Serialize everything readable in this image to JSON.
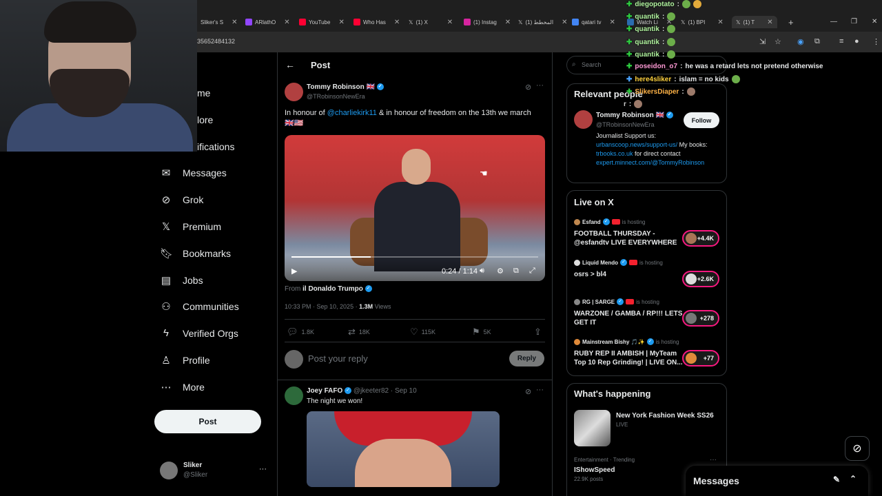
{
  "browser": {
    "tabs": [
      {
        "label": "Sliker's S",
        "color": "#7a7a7a"
      },
      {
        "label": "ARlathO",
        "color": "#9146ff"
      },
      {
        "label": "YouTube",
        "color": "#ff0033"
      },
      {
        "label": "Who Has",
        "color": "#ff0033"
      },
      {
        "label": "(1) X",
        "color": "#000000"
      },
      {
        "label": "(1) Instag",
        "color": "#d6249f"
      },
      {
        "label": "المخطط (1)",
        "color": "#000000"
      },
      {
        "label": "qatari tv",
        "color": "#4285f4"
      },
      {
        "label": "Watch Li",
        "color": "#2b6cb0"
      },
      {
        "label": "(1) BPI",
        "color": "#000000"
      },
      {
        "label": "(1) T",
        "color": "#000000"
      }
    ],
    "address": "35652484132",
    "new_tab": "+"
  },
  "sidebar": {
    "partial_items": [
      "me",
      "lore",
      "ifications"
    ],
    "items": [
      {
        "label": "Messages",
        "icon": "mail-icon"
      },
      {
        "label": "Grok",
        "icon": "grok-icon"
      },
      {
        "label": "Premium",
        "icon": "x-logo-icon"
      },
      {
        "label": "Bookmarks",
        "icon": "bookmark-icon"
      },
      {
        "label": "Jobs",
        "icon": "briefcase-icon"
      },
      {
        "label": "Communities",
        "icon": "communities-icon"
      },
      {
        "label": "Verified Orgs",
        "icon": "lightning-icon"
      },
      {
        "label": "Profile",
        "icon": "person-icon"
      },
      {
        "label": "More",
        "icon": "more-circle-icon"
      }
    ],
    "post_label": "Post",
    "account": {
      "name": "Sliker",
      "handle": "@Sliker",
      "more": "···"
    }
  },
  "main": {
    "header_title": "Post",
    "tweet": {
      "author": "Tommy Robinson 🇬🇧",
      "handle": "@TRobinsonNewEra",
      "text_prefix": "In honour of ",
      "mention": "@charliekirk11",
      "text_suffix": " & in honour of freedom on the 13th we march",
      "flags": "🇬🇧🇺🇸",
      "video_time": "0:24 / 1:14",
      "video_progress": 0.32,
      "from_label": "From",
      "from_name": "il Donaldo Trumpo",
      "timestamp": "10:33 PM · Sep 10, 2025 · ",
      "views_count": "1.3M",
      "views_label": " Views",
      "replies": "1.8K",
      "reposts": "18K",
      "likes": "115K",
      "bookmarks": "5K"
    },
    "reply_placeholder": "Post your reply",
    "reply_button": "Reply",
    "second_tweet": {
      "author": "Joey FAFO",
      "handle": "@jkeeter82 · Sep 10",
      "text": "The night we won!"
    }
  },
  "right": {
    "search_placeholder": "Search",
    "relevant_title": "Relevant people",
    "person": {
      "name": "Tommy Robinson 🇬🇧",
      "handle": "@TRobinsonNewEra",
      "follow": "Follow",
      "bio_1": "Journalist Support us:",
      "link_1": "urbanscoop.news/support-us/",
      "bio_2": " My books: ",
      "link_2": "trbooks.co.uk",
      "bio_3": " for direct contact",
      "link_3": "expert.minnect.com/@TommyRobinson"
    },
    "live_title": "Live on X",
    "live": [
      {
        "host": "Esfand",
        "status": "is hosting",
        "title": "FOOTBALL THURSDAY - @esfandtv LIVE EVERYWHERE",
        "count": "+4.4K"
      },
      {
        "host": "Liquid Mendo",
        "status": "is hosting",
        "title": "osrs > bl4",
        "count": "+2.6K"
      },
      {
        "host": "RG | SARGE",
        "status": "is hosting",
        "title": "WARZONE / GAMBA / RP!!! LETS GET IT",
        "count": "+278"
      },
      {
        "host": "Mainstream Bishy 🎵✨",
        "status": "is hosting",
        "title": "RUBY REP II AMBISH | MyTeam Top 10 Rep Grinding! | LIVE ON...",
        "count": "+77"
      }
    ],
    "happening_title": "What's happening",
    "happening": [
      {
        "title": "New York Fashion Week SS26",
        "meta": "LIVE"
      },
      {
        "meta": "Entertainment · Trending",
        "title": "IShowSpeed",
        "posts": "22.9K posts"
      }
    ]
  },
  "messages_bar": {
    "label": "Messages"
  },
  "chat_overlay": [
    {
      "user": "diegopotato",
      "msg": ""
    },
    {
      "user": "quantik",
      "msg": ""
    },
    {
      "user": "quantik",
      "msg": ""
    },
    {
      "user": "quantik",
      "msg": ""
    },
    {
      "user": "quantik",
      "msg": ""
    },
    {
      "user": "poseidon_o7",
      "msg": "he was a retard lets not pretend otherwise"
    },
    {
      "user": "here4sliker",
      "msg": "islam = no kids"
    },
    {
      "user": "SlikersDiaper",
      "msg": ""
    },
    {
      "user": "r",
      "msg": ""
    }
  ],
  "colors": {
    "accent": "#1d9bf0",
    "live": "#f91880",
    "bg": "#000000"
  }
}
